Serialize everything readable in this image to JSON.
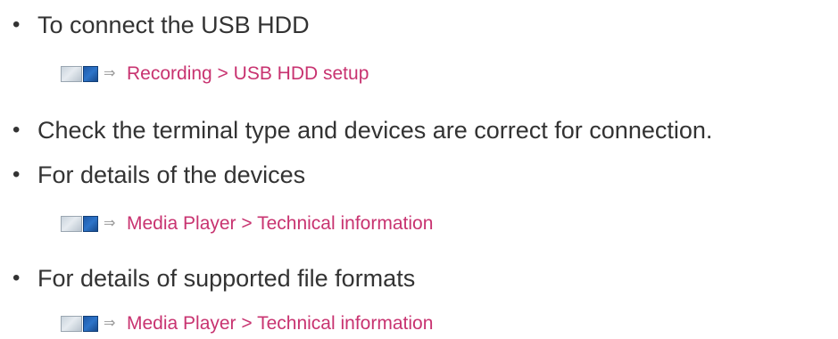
{
  "items": [
    {
      "bullet_text": "To connect the USB HDD",
      "link": {
        "icon": "tv-menu-icon",
        "arrow": "⇒",
        "text": "Recording   > USB HDD setup"
      }
    },
    {
      "bullet_text": "Check the terminal type and devices are correct for connection."
    },
    {
      "bullet_text": "For details of the devices",
      "link": {
        "icon": "tv-menu-icon",
        "arrow": "⇒",
        "text": "Media Player > Technical information"
      }
    },
    {
      "bullet_text": "For details of supported file formats",
      "link": {
        "icon": "tv-menu-icon",
        "arrow": "⇒",
        "text": "Media Player > Technical information"
      }
    }
  ],
  "bullet_symbol": "•",
  "colors": {
    "text": "#333333",
    "link": "#c83370",
    "arrow": "#9a9a9a",
    "icon_blue": "#2d74c9"
  }
}
